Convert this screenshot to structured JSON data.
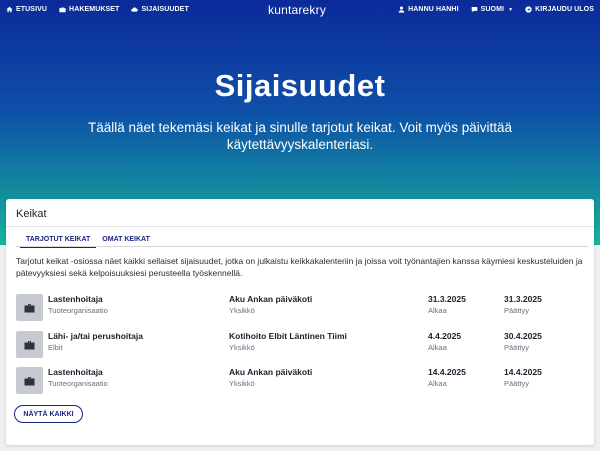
{
  "nav": {
    "left": [
      {
        "label": "ETUSIVU",
        "icon": "home-icon"
      },
      {
        "label": "HAKEMUKSET",
        "icon": "briefcase-icon"
      },
      {
        "label": "SIJAISUUDET",
        "icon": "cloud-icon"
      }
    ],
    "brand": "kuntarekry",
    "user": {
      "label": "HANNU HANHI",
      "icon": "user-icon"
    },
    "language": {
      "label": "SUOMI",
      "icon": "chat-icon"
    },
    "logout": {
      "label": "KIRJAUDU ULOS",
      "icon": "logout-icon"
    }
  },
  "hero": {
    "title": "Sijaisuudet",
    "subtitle": "Täällä näet tekemäsi keikat ja sinulle tarjotut keikat. Voit myös päivittää käytettävyyskalenteriasi."
  },
  "card": {
    "title": "Keikat",
    "tabs": [
      {
        "label": "TARJOTUT KEIKAT",
        "active": true
      },
      {
        "label": "OMAT KEIKAT",
        "active": false
      }
    ],
    "description": "Tarjotut keikat -osiossa näet kaikki sellaiset sijaisuudet, jotka on julkaistu keikkakalenteriin ja joissa voit työnantajien kanssa käymiesi keskusteluiden ja pätevyyksiesi sekä kelpoisuuksiesi perusteella työskennellä.",
    "rows": [
      {
        "title": "Lastenhoitaja",
        "org": "Tuoteorganisaatio",
        "unit": "Aku Ankan päiväkoti",
        "unit_label": "Yksikkö",
        "start": "31.3.2025",
        "start_label": "Alkaa",
        "end": "31.3.2025",
        "end_label": "Päättyy"
      },
      {
        "title": "Lähi- ja/tai perushoitaja",
        "org": "Elbit",
        "unit": "Kotihoito Elbit Läntinen Tiimi",
        "unit_label": "Yksikkö",
        "start": "4.4.2025",
        "start_label": "Alkaa",
        "end": "30.4.2025",
        "end_label": "Päättyy"
      },
      {
        "title": "Lastenhoitaja",
        "org": "Tuoteorganisaatio",
        "unit": "Aku Ankan päiväkoti",
        "unit_label": "Yksikkö",
        "start": "14.4.2025",
        "start_label": "Alkaa",
        "end": "14.4.2025",
        "end_label": "Päättyy"
      }
    ],
    "show_all": "NÄYTÄ KAIKKI"
  },
  "colors": {
    "hero_top": "#0c2a9a",
    "hero_bottom": "#16b49a",
    "accent": "#1a237e",
    "icon_box": "#c6c9d0"
  }
}
